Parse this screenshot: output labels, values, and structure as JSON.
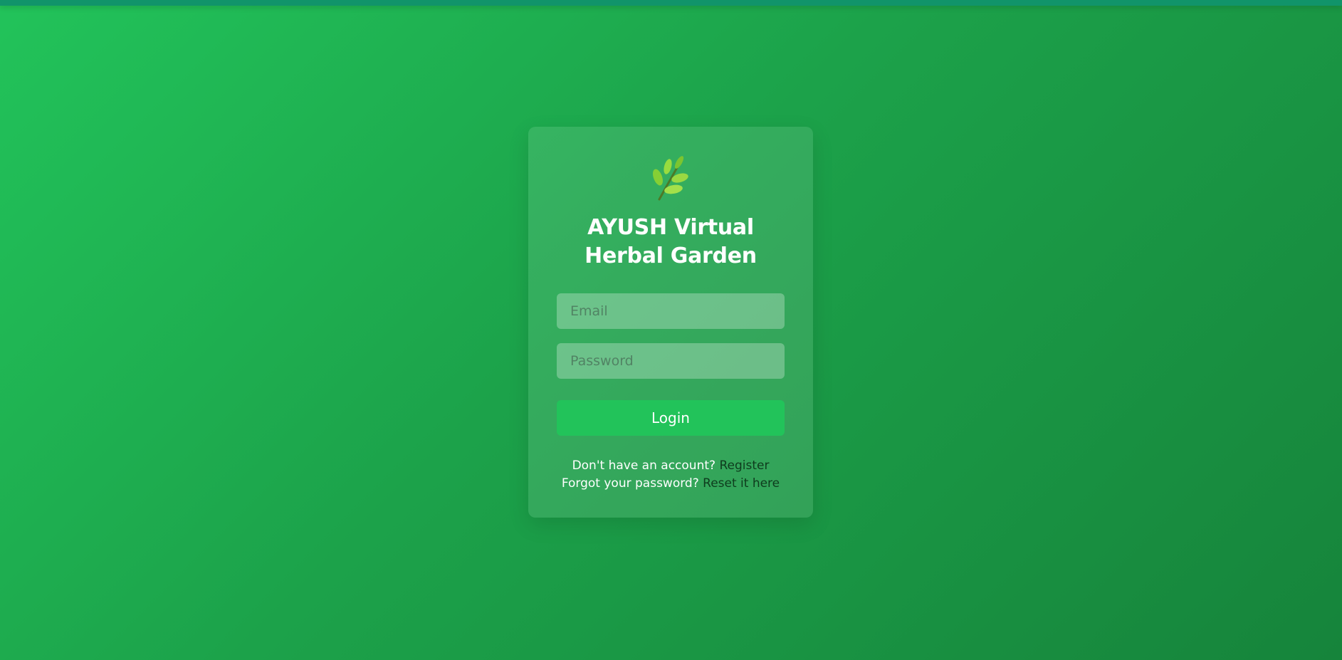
{
  "app": {
    "title": "AYUSH Virtual Herbal Garden",
    "logo_icon": "herb-leaf-icon"
  },
  "form": {
    "email_placeholder": "Email",
    "email_value": "",
    "password_placeholder": "Password",
    "password_value": "",
    "login_label": "Login"
  },
  "links": {
    "register_prompt": "Don't have an account?",
    "register_label": "Register",
    "reset_prompt": "Forgot your password?",
    "reset_label": "Reset it here"
  },
  "colors": {
    "background_start": "#22c35a",
    "background_end": "#16843b",
    "top_bar": "#11946a",
    "button": "#22c35a",
    "link": "#0e3b1d",
    "leaf_light": "#8fd63a",
    "leaf_dark": "#5fa82c"
  }
}
